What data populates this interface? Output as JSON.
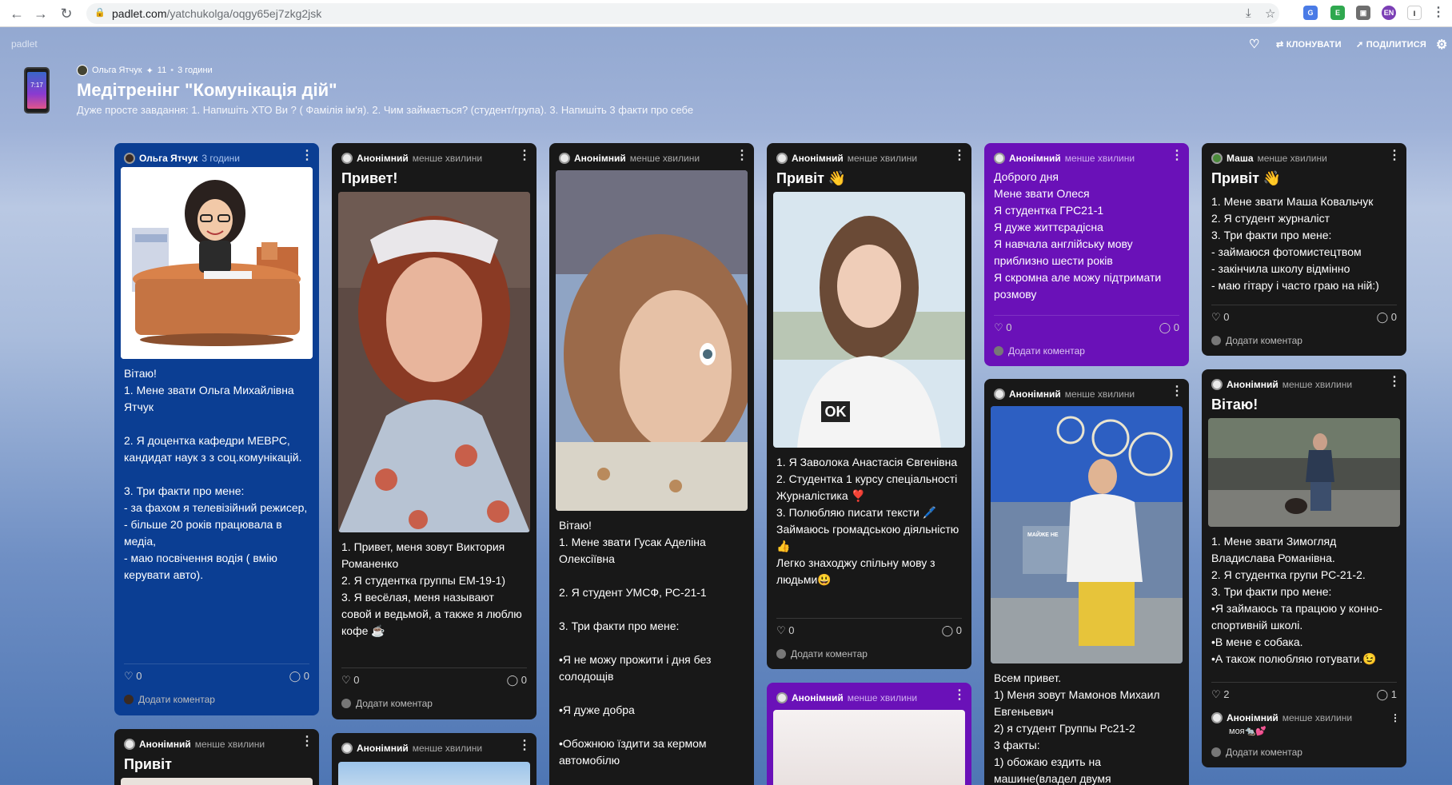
{
  "browser": {
    "url_domain": "padlet.com",
    "url_path": "/yatchukolga/oqgy65ej7zkg2jsk"
  },
  "header": {
    "logo": "padlet",
    "clone_label": "КЛОНУВАТИ",
    "share_label": "ПОДІЛИТИСЯ",
    "phone_time": "7:17",
    "author": "Ольга Ятчук",
    "count": "11",
    "time": "3 години",
    "title": "Медітренінг \"Комунікація дій\"",
    "subtitle": "Дуже просте завдання: 1. Напишіть ХТО Ви ? ( Фамілія ім'я). 2. Чим займається? (студент/група). 3. Напишіть 3 факти про себе"
  },
  "common": {
    "add_comment": "Додати коментар",
    "anon": "Анонімний",
    "recent": "менше хвилини"
  },
  "cards": [
    {
      "author": "Ольга Ятчук",
      "time": "3 години",
      "body": " Вітаю!\n1. Мене звати Ольга Михайлівна Ятчук\n\n2. Я доцентка кафедри МЕВРС, кандидат наук з з соц.комунікацій.\n\n3. Три факти про мене:\n- за фахом  я телевізійний режисер,\n- більше 20 років працювала в медіа,\n- маю посвічення водія  ( вмію керувати авто).",
      "likes": "0",
      "comments": "0"
    },
    {
      "title": "Привет!",
      "body": "1. Привет, меня зовут Виктория Романенко\n2. Я студентка группы ЕМ-19-1)\n3. Я весёлая, меня называют совой и ведьмой, а также я люблю кофе ☕",
      "likes": "0",
      "comments": "0"
    },
    {
      "body": "Вітаю!\n1. Мене звати Гусак Аделіна Олексіївна\n\n2. Я студент УМСФ, РС-21-1\n\n3. Три факти про мене:\n\n•Я не можу прожити і дня без солодощів\n\n•Я дуже добра\n\n•Обожнюю їздити за кермом автомобілю"
    },
    {
      "title": "Привіт 👋",
      "body": "1. Я Заволока Анастасія Євгенівна\n2. Студентка 1 курсу спеціальності Журналістика ❣️\n3. Полюбляю писати тексти 🖊️\nЗаймаюсь громадською діяльністю👍\nЛегко знаходжу спільну мову з людьми😃",
      "likes": "0",
      "comments": "0",
      "tshirt_text": "OK"
    },
    {
      "body": "Доброго дня\nМене звати Олеся\nЯ студентка ГРС21-1\nЯ дуже життєрадісна\nЯ навчала англійську мову приблизно шести років\nЯ скромна але можу підтримати розмову",
      "likes": "0",
      "comments": "0"
    },
    {
      "author": "Маша",
      "title": "Привіт 👋",
      "body": "1. Мене звати Маша Ковальчук\n2. Я студент журналіст\n3. Три факти про мене:\n- займаюся фотомистецтвом\n- закінчила школу відмінно\n- маю гітару і часто граю на ній:)",
      "likes": "0",
      "comments": "0"
    },
    {
      "title": "Привіт"
    },
    {},
    {},
    {
      "body": "Всем привет.\n1) Меня зовут Мамонов Михаил Евгеньевич\n2) я студент Группы Рс21-2\n3 факты:\n1) обожаю ездить на машине(владел двумя",
      "shop_text": "МАЙЖЕ НЕ"
    },
    {
      "title": "Вітаю!",
      "body": "1. Мене звати Зимогляд Владислава Романівна.\n2. Я студентка групи РС-21-2.\n3. Три факти про мене:\n •Я займаюсь та працюю у конно-спортивній школі.\n•В мене є собака.\n•А також полюбляю готувати.😉",
      "likes": "2",
      "comments": "1",
      "comment_text": "моя🐀💕"
    }
  ],
  "colors": {
    "card_dark": "#181818",
    "card_blue": "#0b3e93",
    "card_purple": "#6a11b8"
  }
}
